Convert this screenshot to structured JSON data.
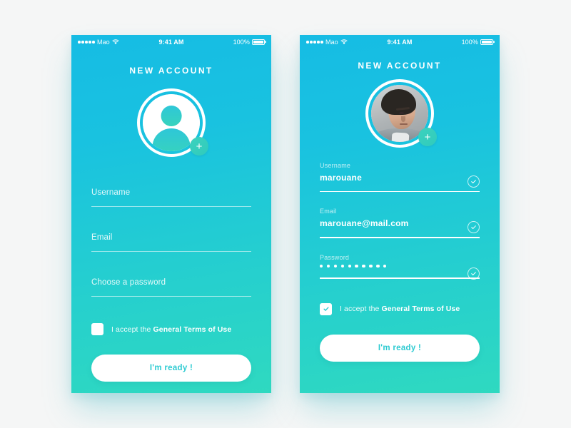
{
  "colors": {
    "gradient_top": "#16bce4",
    "gradient_bottom": "#2fd9c0",
    "accent_text": "#2ecbd2",
    "surface": "#ffffff",
    "page_background": "#f5f6f6",
    "plus_badge": "#3dd2bd"
  },
  "status_bar": {
    "carrier": "Mao",
    "signal_dots": 5,
    "wifi_icon": "wifi-icon",
    "time": "9:41 AM",
    "battery_percent": "100%",
    "battery_icon": "battery-full-icon"
  },
  "screens": [
    {
      "id": "empty-state",
      "title": "NEW ACCOUNT",
      "avatar": {
        "type": "placeholder",
        "icon": "user-silhouette-icon",
        "add_badge_label": "+"
      },
      "fields": [
        {
          "name": "username",
          "label": "",
          "placeholder": "Username",
          "value": "",
          "valid": false
        },
        {
          "name": "email",
          "label": "",
          "placeholder": "Email",
          "value": "",
          "valid": false
        },
        {
          "name": "password",
          "label": "",
          "placeholder": "Choose a password",
          "value": "",
          "valid": false
        }
      ],
      "terms": {
        "checked": false,
        "prefix": "I accept the ",
        "link": "General Terms of Use"
      },
      "cta": "I'm ready !"
    },
    {
      "id": "filled-state",
      "title": "NEW ACCOUNT",
      "avatar": {
        "type": "photo",
        "icon": "user-photo-avatar",
        "add_badge_label": "+"
      },
      "fields": [
        {
          "name": "username",
          "label": "Username",
          "placeholder": "Username",
          "value": "marouane",
          "valid": true
        },
        {
          "name": "email",
          "label": "Email",
          "placeholder": "Email",
          "value": "marouane@mail.com",
          "valid": true
        },
        {
          "name": "password",
          "label": "Password",
          "placeholder": "Password",
          "value": "",
          "masked_length": 10,
          "valid": true
        }
      ],
      "terms": {
        "checked": true,
        "prefix": "I accept the ",
        "link": "General Terms of Use"
      },
      "cta": "I'm ready !"
    }
  ]
}
